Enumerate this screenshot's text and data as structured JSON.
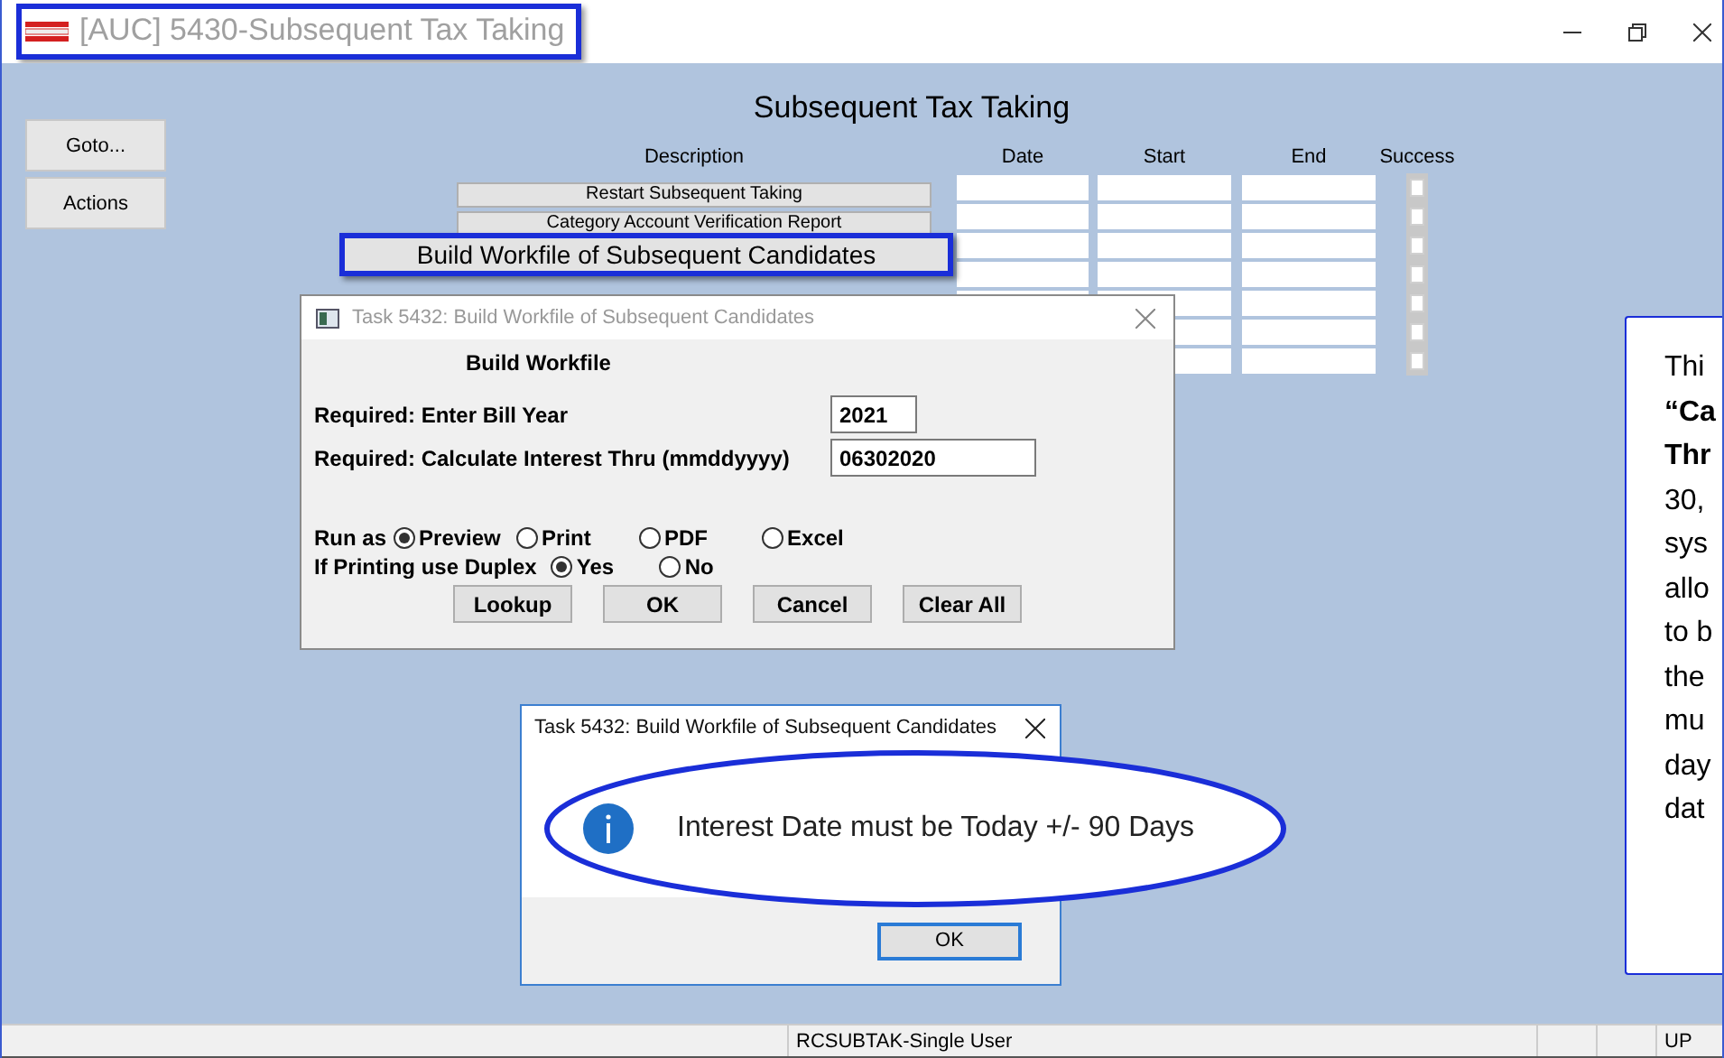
{
  "window": {
    "title": "[AUC] 5430-Subsequent Tax Taking",
    "title_highlighted": true
  },
  "side_buttons": [
    "Goto...",
    "Actions"
  ],
  "heading": "Subsequent Tax Taking",
  "table": {
    "columns": [
      "Description",
      "Date",
      "Start",
      "End",
      "Success"
    ],
    "rows": [
      {
        "description": "Restart Subsequent Taking",
        "highlighted": false,
        "success": false
      },
      {
        "description": "Category Account Verification Report",
        "highlighted": false,
        "success": false
      },
      {
        "description": "Build Workfile of Subsequent Candidates",
        "highlighted": true,
        "success": false
      },
      {
        "success": false
      },
      {
        "success": false
      },
      {
        "success": false
      },
      {
        "success": false
      }
    ]
  },
  "dialog": {
    "title": "Task 5432: Build Workfile of Subsequent Candidates",
    "heading": "Build Workfile",
    "fields": [
      {
        "label": "Required: Enter Bill Year",
        "value": "2021"
      },
      {
        "label": "Required: Calculate Interest Thru (mmddyyyy)",
        "value": "06302020"
      }
    ],
    "run_as": {
      "label": "Run as",
      "options": [
        {
          "label": "Preview",
          "selected": true
        },
        {
          "label": "Print",
          "selected": false
        },
        {
          "label": "PDF",
          "selected": false
        },
        {
          "label": "Excel",
          "selected": false
        }
      ]
    },
    "duplex": {
      "label": "If Printing use Duplex",
      "options": [
        {
          "label": "Yes",
          "selected": true
        },
        {
          "label": "No",
          "selected": false
        }
      ]
    },
    "buttons": [
      "Lookup",
      "OK",
      "Cancel",
      "Clear All"
    ]
  },
  "message_box": {
    "title": "Task 5432: Build Workfile of Subsequent Candidates",
    "message": "Interest Date must be Today +/- 90 Days",
    "highlighted": true,
    "button": "OK"
  },
  "callout": {
    "lines": [
      {
        "text": "Thi",
        "bold": false
      },
      {
        "text": "“Ca",
        "bold": true
      },
      {
        "text": "Thr",
        "bold": true
      },
      {
        "text": "30,",
        "bold": false
      },
      {
        "text": "sys",
        "bold": false
      },
      {
        "text": "allo",
        "bold": false
      },
      {
        "text": "to b",
        "bold": false
      },
      {
        "text": "the",
        "bold": false
      },
      {
        "text": "mu",
        "bold": false
      },
      {
        "text": "day",
        "bold": false
      },
      {
        "text": "dat",
        "bold": false
      }
    ]
  },
  "status_bar": {
    "text": "RCSUBTAK-Single User",
    "mode": "UP"
  }
}
